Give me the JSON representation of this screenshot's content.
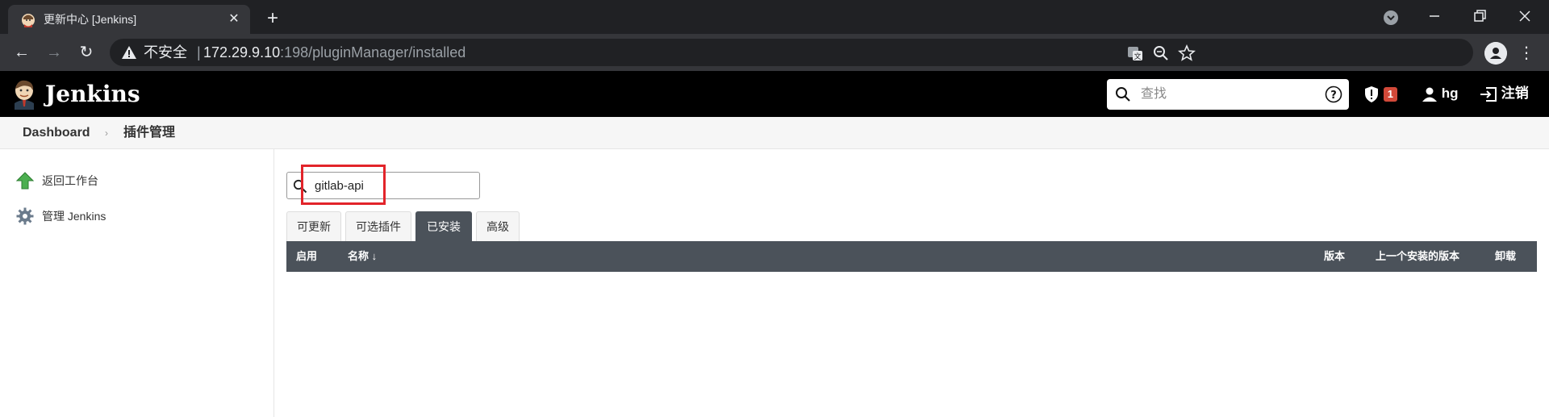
{
  "browser": {
    "tab_title": "更新中心 [Jenkins]",
    "tab_close": "✕",
    "new_tab": "+",
    "insecure_label": "不安全",
    "url_host": "172.29.9.10",
    "url_rest": ":198/pluginManager/installed",
    "back": "←",
    "forward": "→",
    "reload": "↻",
    "menu": "⋮"
  },
  "header": {
    "title": "Jenkins",
    "search_placeholder": "查找",
    "alert_count": "1",
    "user": "hg",
    "logout": "注销"
  },
  "breadcrumb": {
    "items": [
      "Dashboard",
      "插件管理"
    ]
  },
  "sidebar": {
    "items": [
      {
        "label": "返回工作台",
        "icon": "up-arrow-icon"
      },
      {
        "label": "管理 Jenkins",
        "icon": "gear-icon"
      }
    ]
  },
  "filter": {
    "value": "gitlab-api"
  },
  "tabs": [
    {
      "label": "可更新",
      "active": false
    },
    {
      "label": "可选插件",
      "active": false
    },
    {
      "label": "已安装",
      "active": true
    },
    {
      "label": "高级",
      "active": false
    }
  ],
  "table": {
    "columns": [
      "启用",
      "名称 ↓",
      "版本",
      "上一个安装的版本",
      "卸载"
    ]
  },
  "colors": {
    "jenkins_header": "#000000",
    "table_header": "#4b525a",
    "highlight_box": "#e2242a",
    "badge": "#d24939"
  }
}
